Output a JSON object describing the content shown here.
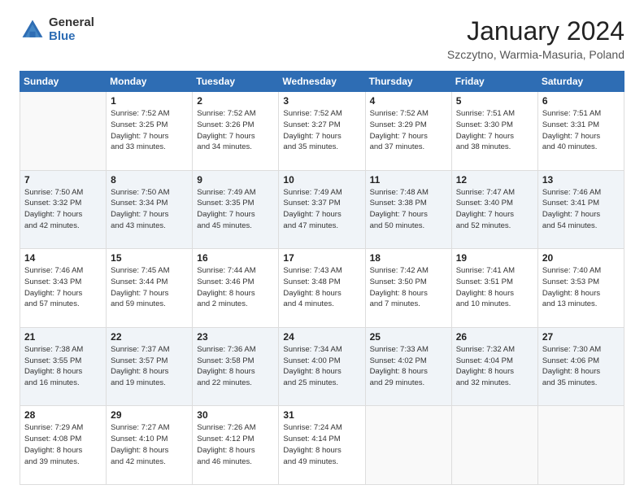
{
  "logo": {
    "general": "General",
    "blue": "Blue"
  },
  "title": {
    "month": "January 2024",
    "location": "Szczytno, Warmia-Masuria, Poland"
  },
  "days_of_week": [
    "Sunday",
    "Monday",
    "Tuesday",
    "Wednesday",
    "Thursday",
    "Friday",
    "Saturday"
  ],
  "weeks": [
    [
      {
        "day": "",
        "info": ""
      },
      {
        "day": "1",
        "info": "Sunrise: 7:52 AM\nSunset: 3:25 PM\nDaylight: 7 hours\nand 33 minutes."
      },
      {
        "day": "2",
        "info": "Sunrise: 7:52 AM\nSunset: 3:26 PM\nDaylight: 7 hours\nand 34 minutes."
      },
      {
        "day": "3",
        "info": "Sunrise: 7:52 AM\nSunset: 3:27 PM\nDaylight: 7 hours\nand 35 minutes."
      },
      {
        "day": "4",
        "info": "Sunrise: 7:52 AM\nSunset: 3:29 PM\nDaylight: 7 hours\nand 37 minutes."
      },
      {
        "day": "5",
        "info": "Sunrise: 7:51 AM\nSunset: 3:30 PM\nDaylight: 7 hours\nand 38 minutes."
      },
      {
        "day": "6",
        "info": "Sunrise: 7:51 AM\nSunset: 3:31 PM\nDaylight: 7 hours\nand 40 minutes."
      }
    ],
    [
      {
        "day": "7",
        "info": "Sunrise: 7:50 AM\nSunset: 3:32 PM\nDaylight: 7 hours\nand 42 minutes."
      },
      {
        "day": "8",
        "info": "Sunrise: 7:50 AM\nSunset: 3:34 PM\nDaylight: 7 hours\nand 43 minutes."
      },
      {
        "day": "9",
        "info": "Sunrise: 7:49 AM\nSunset: 3:35 PM\nDaylight: 7 hours\nand 45 minutes."
      },
      {
        "day": "10",
        "info": "Sunrise: 7:49 AM\nSunset: 3:37 PM\nDaylight: 7 hours\nand 47 minutes."
      },
      {
        "day": "11",
        "info": "Sunrise: 7:48 AM\nSunset: 3:38 PM\nDaylight: 7 hours\nand 50 minutes."
      },
      {
        "day": "12",
        "info": "Sunrise: 7:47 AM\nSunset: 3:40 PM\nDaylight: 7 hours\nand 52 minutes."
      },
      {
        "day": "13",
        "info": "Sunrise: 7:46 AM\nSunset: 3:41 PM\nDaylight: 7 hours\nand 54 minutes."
      }
    ],
    [
      {
        "day": "14",
        "info": "Sunrise: 7:46 AM\nSunset: 3:43 PM\nDaylight: 7 hours\nand 57 minutes."
      },
      {
        "day": "15",
        "info": "Sunrise: 7:45 AM\nSunset: 3:44 PM\nDaylight: 7 hours\nand 59 minutes."
      },
      {
        "day": "16",
        "info": "Sunrise: 7:44 AM\nSunset: 3:46 PM\nDaylight: 8 hours\nand 2 minutes."
      },
      {
        "day": "17",
        "info": "Sunrise: 7:43 AM\nSunset: 3:48 PM\nDaylight: 8 hours\nand 4 minutes."
      },
      {
        "day": "18",
        "info": "Sunrise: 7:42 AM\nSunset: 3:50 PM\nDaylight: 8 hours\nand 7 minutes."
      },
      {
        "day": "19",
        "info": "Sunrise: 7:41 AM\nSunset: 3:51 PM\nDaylight: 8 hours\nand 10 minutes."
      },
      {
        "day": "20",
        "info": "Sunrise: 7:40 AM\nSunset: 3:53 PM\nDaylight: 8 hours\nand 13 minutes."
      }
    ],
    [
      {
        "day": "21",
        "info": "Sunrise: 7:38 AM\nSunset: 3:55 PM\nDaylight: 8 hours\nand 16 minutes."
      },
      {
        "day": "22",
        "info": "Sunrise: 7:37 AM\nSunset: 3:57 PM\nDaylight: 8 hours\nand 19 minutes."
      },
      {
        "day": "23",
        "info": "Sunrise: 7:36 AM\nSunset: 3:58 PM\nDaylight: 8 hours\nand 22 minutes."
      },
      {
        "day": "24",
        "info": "Sunrise: 7:34 AM\nSunset: 4:00 PM\nDaylight: 8 hours\nand 25 minutes."
      },
      {
        "day": "25",
        "info": "Sunrise: 7:33 AM\nSunset: 4:02 PM\nDaylight: 8 hours\nand 29 minutes."
      },
      {
        "day": "26",
        "info": "Sunrise: 7:32 AM\nSunset: 4:04 PM\nDaylight: 8 hours\nand 32 minutes."
      },
      {
        "day": "27",
        "info": "Sunrise: 7:30 AM\nSunset: 4:06 PM\nDaylight: 8 hours\nand 35 minutes."
      }
    ],
    [
      {
        "day": "28",
        "info": "Sunrise: 7:29 AM\nSunset: 4:08 PM\nDaylight: 8 hours\nand 39 minutes."
      },
      {
        "day": "29",
        "info": "Sunrise: 7:27 AM\nSunset: 4:10 PM\nDaylight: 8 hours\nand 42 minutes."
      },
      {
        "day": "30",
        "info": "Sunrise: 7:26 AM\nSunset: 4:12 PM\nDaylight: 8 hours\nand 46 minutes."
      },
      {
        "day": "31",
        "info": "Sunrise: 7:24 AM\nSunset: 4:14 PM\nDaylight: 8 hours\nand 49 minutes."
      },
      {
        "day": "",
        "info": ""
      },
      {
        "day": "",
        "info": ""
      },
      {
        "day": "",
        "info": ""
      }
    ]
  ]
}
